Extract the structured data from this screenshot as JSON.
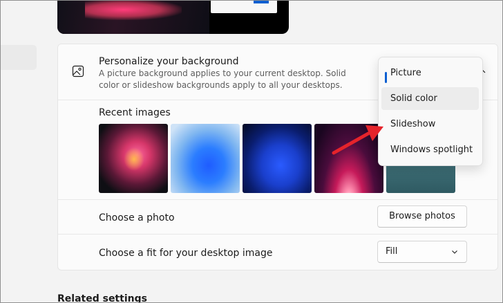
{
  "background": {
    "title": "Personalize your background",
    "subtitle": "A picture background applies to your current desktop. Solid color or slideshow backgrounds apply to all your desktops.",
    "recent_images_label": "Recent images",
    "dropdown": {
      "options": [
        "Picture",
        "Solid color",
        "Slideshow",
        "Windows spotlight"
      ],
      "selected": "Picture",
      "hovered": "Solid color"
    }
  },
  "photo_row": {
    "label": "Choose a photo",
    "button_label": "Browse photos"
  },
  "fit_row": {
    "label": "Choose a fit for your desktop image",
    "selected_value": "Fill"
  },
  "related_settings_heading": "Related settings",
  "colors": {
    "accent": "#0b5fd1",
    "annotation_arrow": "#e5232b"
  },
  "icons": [
    "picture-icon",
    "chevron-up-icon",
    "chevron-down-icon"
  ]
}
